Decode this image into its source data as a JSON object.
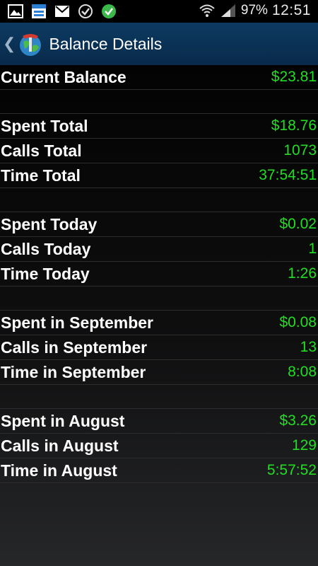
{
  "status_bar": {
    "icons_left": [
      "image-icon",
      "calendar-news-icon",
      "gmail-icon",
      "check-circle-outline-icon",
      "check-circle-filled-icon"
    ],
    "battery": "97%",
    "time": "12:51"
  },
  "action_bar": {
    "title": "Balance Details"
  },
  "colors": {
    "value_green": "#22dd22",
    "action_bar_blue": "#0d3a62"
  },
  "groups": [
    {
      "rows": [
        {
          "label": "Current Balance",
          "value": "$23.81"
        }
      ]
    },
    {
      "rows": [
        {
          "label": "Spent Total",
          "value": "$18.76"
        },
        {
          "label": "Calls Total",
          "value": "1073"
        },
        {
          "label": "Time Total",
          "value": "37:54:51"
        }
      ]
    },
    {
      "rows": [
        {
          "label": "Spent Today",
          "value": "$0.02"
        },
        {
          "label": "Calls Today",
          "value": "1"
        },
        {
          "label": "Time Today",
          "value": "1:26"
        }
      ]
    },
    {
      "rows": [
        {
          "label": "Spent in September",
          "value": "$0.08"
        },
        {
          "label": "Calls in September",
          "value": "13"
        },
        {
          "label": "Time in September",
          "value": "8:08"
        }
      ]
    },
    {
      "rows": [
        {
          "label": "Spent in August",
          "value": "$3.26"
        },
        {
          "label": "Calls in August",
          "value": "129"
        },
        {
          "label": "Time in August",
          "value": "5:57:52"
        }
      ]
    }
  ]
}
